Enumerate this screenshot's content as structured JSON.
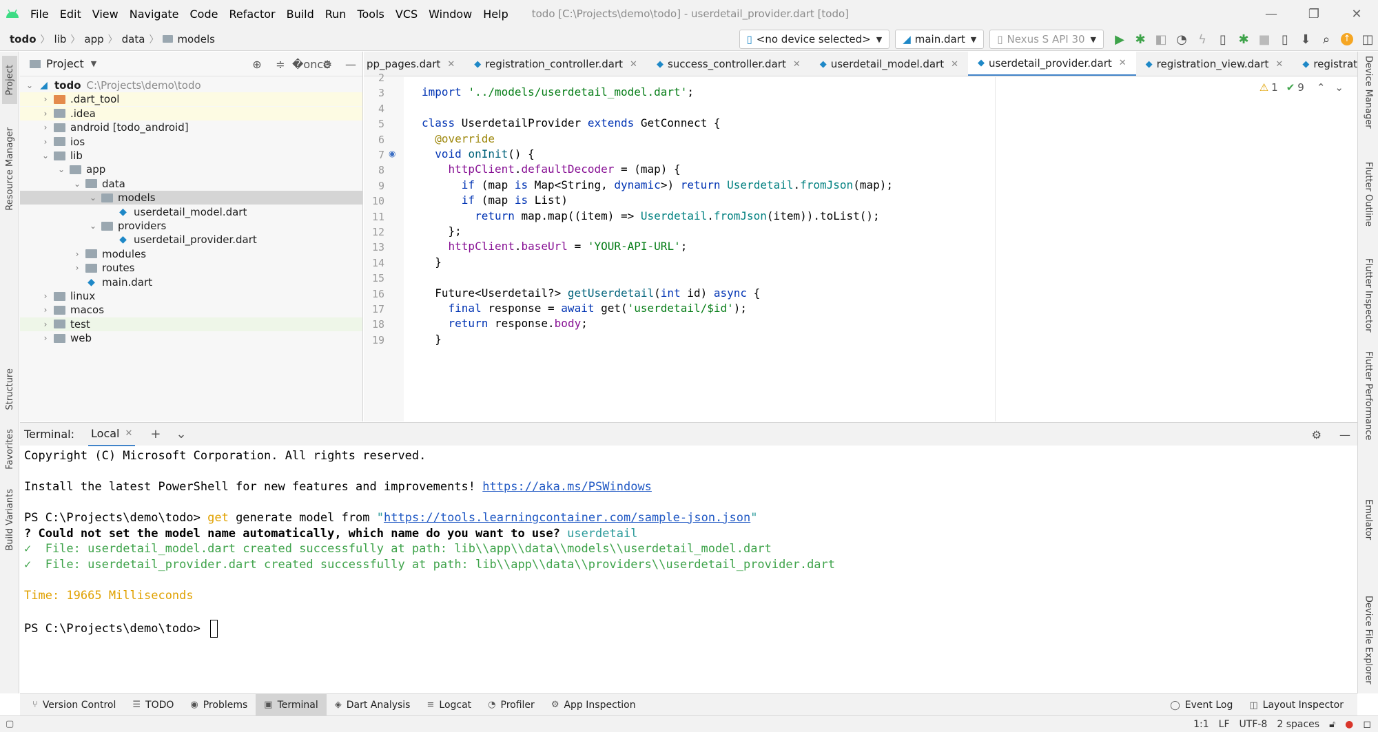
{
  "window": {
    "menu": [
      "File",
      "Edit",
      "View",
      "Navigate",
      "Code",
      "Refactor",
      "Build",
      "Run",
      "Tools",
      "VCS",
      "Window",
      "Help"
    ],
    "title": "todo [C:\\Projects\\demo\\todo] - userdetail_provider.dart [todo]"
  },
  "nav": {
    "breadcrumbs": [
      "todo",
      "lib",
      "app",
      "data",
      "models"
    ],
    "device": "<no device selected>",
    "run_config": "main.dart",
    "emulator": "Nexus S API 30"
  },
  "left_stripe": [
    "Project",
    "Resource Manager",
    "Structure",
    "Favorites",
    "Build Variants"
  ],
  "right_stripe": [
    "Device Manager",
    "Flutter Outline",
    "Flutter Inspector",
    "Flutter Performance",
    "Emulator",
    "Device File Explorer"
  ],
  "project": {
    "title": "Project",
    "tree": [
      {
        "name": "todo",
        "path": "C:\\Projects\\demo\\todo",
        "depth": 0,
        "expanded": true,
        "bold": true,
        "icon": "flutter"
      },
      {
        "name": ".dart_tool",
        "depth": 1,
        "expanded": false,
        "icon": "folder-orange",
        "hl": "yellow"
      },
      {
        "name": ".idea",
        "depth": 1,
        "expanded": false,
        "icon": "folder",
        "hl": "yellow"
      },
      {
        "name": "android [todo_android]",
        "depth": 1,
        "expanded": false,
        "icon": "folder"
      },
      {
        "name": "ios",
        "depth": 1,
        "expanded": false,
        "icon": "folder"
      },
      {
        "name": "lib",
        "depth": 1,
        "expanded": true,
        "icon": "folder"
      },
      {
        "name": "app",
        "depth": 2,
        "expanded": true,
        "icon": "folder"
      },
      {
        "name": "data",
        "depth": 3,
        "expanded": true,
        "icon": "folder"
      },
      {
        "name": "models",
        "depth": 4,
        "expanded": true,
        "icon": "folder",
        "hl": "selected"
      },
      {
        "name": "userdetail_model.dart",
        "depth": 5,
        "icon": "dart"
      },
      {
        "name": "providers",
        "depth": 4,
        "expanded": true,
        "icon": "folder"
      },
      {
        "name": "userdetail_provider.dart",
        "depth": 5,
        "icon": "dart"
      },
      {
        "name": "modules",
        "depth": 3,
        "expanded": false,
        "icon": "folder"
      },
      {
        "name": "routes",
        "depth": 3,
        "expanded": false,
        "icon": "folder"
      },
      {
        "name": "main.dart",
        "depth": 3,
        "icon": "dart"
      },
      {
        "name": "linux",
        "depth": 1,
        "expanded": false,
        "icon": "folder"
      },
      {
        "name": "macos",
        "depth": 1,
        "expanded": false,
        "icon": "folder"
      },
      {
        "name": "test",
        "depth": 1,
        "expanded": false,
        "icon": "folder",
        "hl": "green"
      },
      {
        "name": "web",
        "depth": 1,
        "expanded": false,
        "icon": "folder"
      }
    ]
  },
  "tabs": [
    {
      "label": "pp_pages.dart",
      "active": false
    },
    {
      "label": "registration_controller.dart",
      "active": false
    },
    {
      "label": "success_controller.dart",
      "active": false
    },
    {
      "label": "userdetail_model.dart",
      "active": false
    },
    {
      "label": "userdetail_provider.dart",
      "active": true
    },
    {
      "label": "registration_view.dart",
      "active": false
    },
    {
      "label": "registration_binc",
      "active": false
    }
  ],
  "inspections": {
    "warnings": "1",
    "weak": "9"
  },
  "code": {
    "line_numbers": [
      "2",
      "3",
      "4",
      "5",
      "6",
      "7",
      "8",
      "9",
      "10",
      "11",
      "12",
      "13",
      "14",
      "15",
      "16",
      "17",
      "18",
      "19"
    ],
    "lines": [
      [],
      [
        {
          "t": "import ",
          "c": "kw"
        },
        {
          "t": "'../models/userdetail_model.dart'",
          "c": "str"
        },
        {
          "t": ";",
          "c": ""
        }
      ],
      [],
      [
        {
          "t": "class ",
          "c": "kw"
        },
        {
          "t": "UserdetailProvider ",
          "c": ""
        },
        {
          "t": "extends ",
          "c": "kw"
        },
        {
          "t": "GetConnect {",
          "c": ""
        }
      ],
      [
        {
          "t": "  ",
          "c": ""
        },
        {
          "t": "@override",
          "c": "ann"
        }
      ],
      [
        {
          "t": "  ",
          "c": ""
        },
        {
          "t": "void ",
          "c": "kw"
        },
        {
          "t": "onInit",
          "c": "fn"
        },
        {
          "t": "() {",
          "c": ""
        }
      ],
      [
        {
          "t": "    ",
          "c": ""
        },
        {
          "t": "httpClient",
          "c": "fld"
        },
        {
          "t": ".",
          "c": ""
        },
        {
          "t": "defaultDecoder",
          "c": "fld"
        },
        {
          "t": " = (map) {",
          "c": ""
        }
      ],
      [
        {
          "t": "      ",
          "c": ""
        },
        {
          "t": "if ",
          "c": "kw"
        },
        {
          "t": "(map ",
          "c": ""
        },
        {
          "t": "is ",
          "c": "kw"
        },
        {
          "t": "Map<String, ",
          "c": ""
        },
        {
          "t": "dynamic",
          "c": "kw"
        },
        {
          "t": ">) ",
          "c": ""
        },
        {
          "t": "return ",
          "c": "kw"
        },
        {
          "t": "Userdetail",
          "c": "cls"
        },
        {
          "t": ".",
          "c": ""
        },
        {
          "t": "fromJson",
          "c": "cls"
        },
        {
          "t": "(map);",
          "c": ""
        }
      ],
      [
        {
          "t": "      ",
          "c": ""
        },
        {
          "t": "if ",
          "c": "kw"
        },
        {
          "t": "(map ",
          "c": ""
        },
        {
          "t": "is ",
          "c": "kw"
        },
        {
          "t": "List)",
          "c": ""
        }
      ],
      [
        {
          "t": "        ",
          "c": ""
        },
        {
          "t": "return ",
          "c": "kw"
        },
        {
          "t": "map.map((item) => ",
          "c": ""
        },
        {
          "t": "Userdetail",
          "c": "cls"
        },
        {
          "t": ".",
          "c": ""
        },
        {
          "t": "fromJson",
          "c": "cls"
        },
        {
          "t": "(item)).toList();",
          "c": ""
        }
      ],
      [
        {
          "t": "    };",
          "c": ""
        }
      ],
      [
        {
          "t": "    ",
          "c": ""
        },
        {
          "t": "httpClient",
          "c": "fld"
        },
        {
          "t": ".",
          "c": ""
        },
        {
          "t": "baseUrl",
          "c": "fld"
        },
        {
          "t": " = ",
          "c": ""
        },
        {
          "t": "'YOUR-API-URL'",
          "c": "str"
        },
        {
          "t": ";",
          "c": ""
        }
      ],
      [
        {
          "t": "  }",
          "c": ""
        }
      ],
      [],
      [
        {
          "t": "  Future<Userdetail?> ",
          "c": ""
        },
        {
          "t": "getUserdetail",
          "c": "fn"
        },
        {
          "t": "(",
          "c": ""
        },
        {
          "t": "int ",
          "c": "kw"
        },
        {
          "t": "id) ",
          "c": ""
        },
        {
          "t": "async ",
          "c": "kw"
        },
        {
          "t": "{",
          "c": ""
        }
      ],
      [
        {
          "t": "    ",
          "c": ""
        },
        {
          "t": "final ",
          "c": "kw"
        },
        {
          "t": "response = ",
          "c": ""
        },
        {
          "t": "await ",
          "c": "kw"
        },
        {
          "t": "get(",
          "c": ""
        },
        {
          "t": "'userdetail/$id'",
          "c": "str"
        },
        {
          "t": ");",
          "c": ""
        }
      ],
      [
        {
          "t": "    ",
          "c": ""
        },
        {
          "t": "return ",
          "c": "kw"
        },
        {
          "t": "response.",
          "c": ""
        },
        {
          "t": "body",
          "c": "fld"
        },
        {
          "t": ";",
          "c": ""
        }
      ],
      [
        {
          "t": "  }",
          "c": ""
        }
      ]
    ]
  },
  "terminal": {
    "label": "Terminal:",
    "tab": "Local",
    "lines": [
      [
        {
          "t": "Copyright (C) Microsoft Corporation. All rights reserved.",
          "c": ""
        }
      ],
      [],
      [
        {
          "t": "Install the latest PowerShell for new features and improvements! ",
          "c": ""
        },
        {
          "t": "https://aka.ms/PSWindows",
          "c": "t-link"
        }
      ],
      [],
      [
        {
          "t": "PS C:\\Projects\\demo\\todo> ",
          "c": ""
        },
        {
          "t": "get",
          "c": "t-yellow"
        },
        {
          "t": " generate model from ",
          "c": ""
        },
        {
          "t": "\"",
          "c": "t-cyan"
        },
        {
          "t": "https://tools.learningcontainer.com/sample-json.json",
          "c": "t-link"
        },
        {
          "t": "\"",
          "c": "t-cyan"
        }
      ],
      [
        {
          "t": "? Could not set the model name automatically, which name do you want to use? ",
          "c": "t-bold"
        },
        {
          "t": "userdetail",
          "c": "t-cyan"
        }
      ],
      [
        {
          "t": "✓  File: userdetail_model.dart created successfully at path: lib\\\\app\\\\data\\\\models\\\\userdetail_model.dart",
          "c": "t-green"
        }
      ],
      [
        {
          "t": "✓  File: userdetail_provider.dart created successfully at path: lib\\\\app\\\\data\\\\providers\\\\userdetail_provider.dart",
          "c": "t-green"
        }
      ],
      [],
      [
        {
          "t": "Time: 19665 Milliseconds",
          "c": "t-yellow"
        }
      ],
      [],
      [
        {
          "t": "PS C:\\Projects\\demo\\todo> ",
          "c": ""
        }
      ]
    ]
  },
  "tool_windows": [
    "Version Control",
    "TODO",
    "Problems",
    "Terminal",
    "Dart Analysis",
    "Logcat",
    "Profiler",
    "App Inspection"
  ],
  "tool_windows_right": [
    "Event Log",
    "Layout Inspector"
  ],
  "status": {
    "position": "1:1",
    "line_sep": "LF",
    "encoding": "UTF-8",
    "indent": "2 spaces"
  }
}
